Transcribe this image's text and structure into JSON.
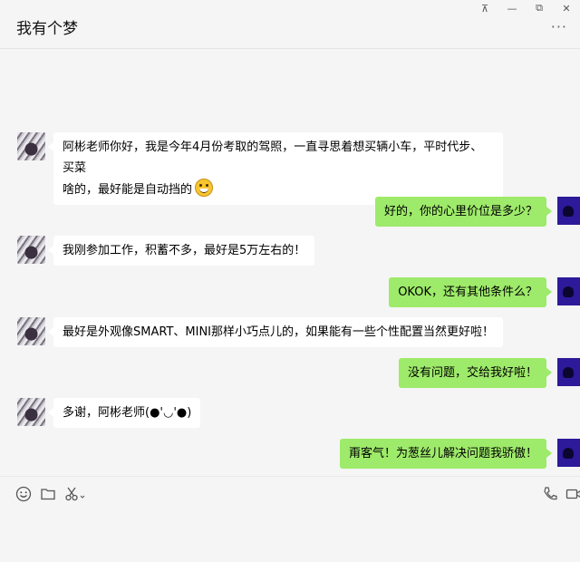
{
  "window": {
    "title": "我有个梦",
    "controls": {
      "pin": "⊼",
      "minimize": "—",
      "maximize": "⧉",
      "close": "✕"
    },
    "more": "···"
  },
  "messages": [
    {
      "side": "left",
      "lines": [
        "阿彬老师你好，我是今年4月份考取的驾照，一直寻思着想买辆小车，平时代步、买菜",
        "啥的，最好能是自动挡的"
      ],
      "emoji": true
    },
    {
      "side": "right",
      "lines": [
        "好的，你的心里价位是多少？"
      ]
    },
    {
      "side": "left",
      "lines": [
        "我刚参加工作，积蓄不多，最好是5万左右的！"
      ]
    },
    {
      "side": "right",
      "lines": [
        "OKOK，还有其他条件么？"
      ]
    },
    {
      "side": "left",
      "lines": [
        "最好是外观像SMART、MINI那样小巧点儿的，如果能有一些个性配置当然更好啦！"
      ]
    },
    {
      "side": "right",
      "lines": [
        "没有问题，交给我好啦！"
      ]
    },
    {
      "side": "left",
      "lines": [
        "多谢，阿彬老师(●'◡'●)"
      ]
    },
    {
      "side": "right",
      "lines": [
        "甭客气！为葱丝儿解决问题我骄傲！"
      ]
    }
  ],
  "toolbar": {
    "emoji_icon": "smiley-icon",
    "folder_icon": "folder-icon",
    "scissors_icon": "scissors-icon",
    "phone_icon": "phone-icon",
    "video_icon": "video-icon"
  },
  "colors": {
    "bubble_self": "#9eea6a",
    "bubble_other": "#ffffff",
    "background": "#f5f5f5"
  }
}
